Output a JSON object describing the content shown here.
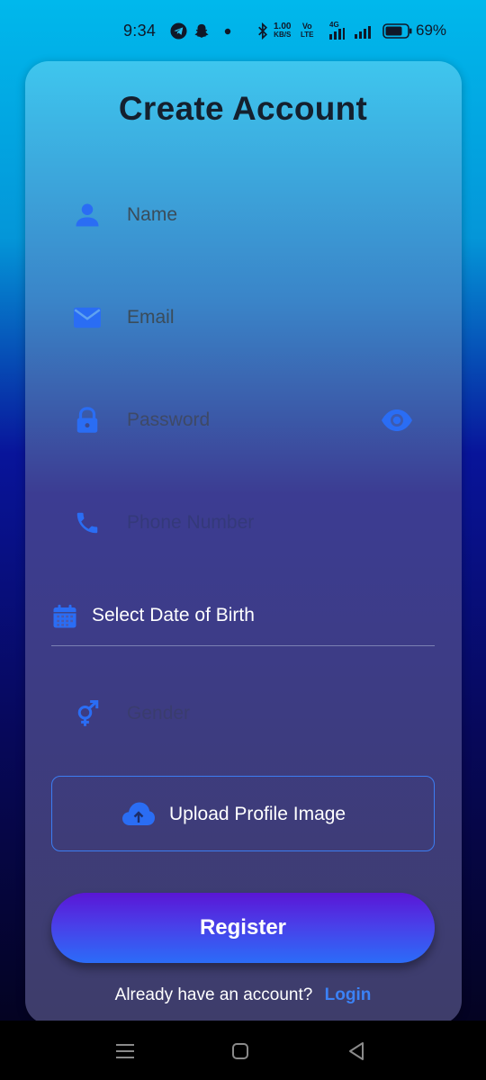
{
  "status_bar": {
    "time": "9:34",
    "net_speed_value": "1.00",
    "net_speed_unit": "KB/S",
    "volte_top": "Vo",
    "volte_bottom": "LTE",
    "network_type": "4G",
    "battery": "69%",
    "icons": [
      "telegram-icon",
      "snapchat-icon",
      "dot-icon",
      "bluetooth-icon",
      "signal-icon",
      "battery-icon"
    ]
  },
  "form": {
    "title": "Create Account",
    "fields": {
      "name": {
        "placeholder": "Name",
        "icon": "person-icon"
      },
      "email": {
        "placeholder": "Email",
        "icon": "mail-icon"
      },
      "password": {
        "placeholder": "Password",
        "icon": "lock-icon",
        "toggle_icon": "eye-icon"
      },
      "phone": {
        "placeholder": "Phone Number",
        "icon": "phone-icon"
      },
      "gender": {
        "placeholder": "Gender",
        "icon": "gender-icon"
      }
    },
    "dob": {
      "label": "Select Date of Birth",
      "icon": "calendar-icon"
    },
    "upload": {
      "label": "Upload Profile Image",
      "icon": "cloud-upload-icon"
    },
    "register_label": "Register",
    "login_prompt": "Already have an account?",
    "login_link": "Login"
  },
  "nav_bar": {
    "icons": [
      "menu-icon",
      "home-icon",
      "back-icon"
    ]
  },
  "colors": {
    "accent": "#3b82f6",
    "icon_blue": "#2a6df4",
    "title": "#14202e",
    "register_start": "#5a16d6",
    "register_end": "#2b6cf8"
  }
}
